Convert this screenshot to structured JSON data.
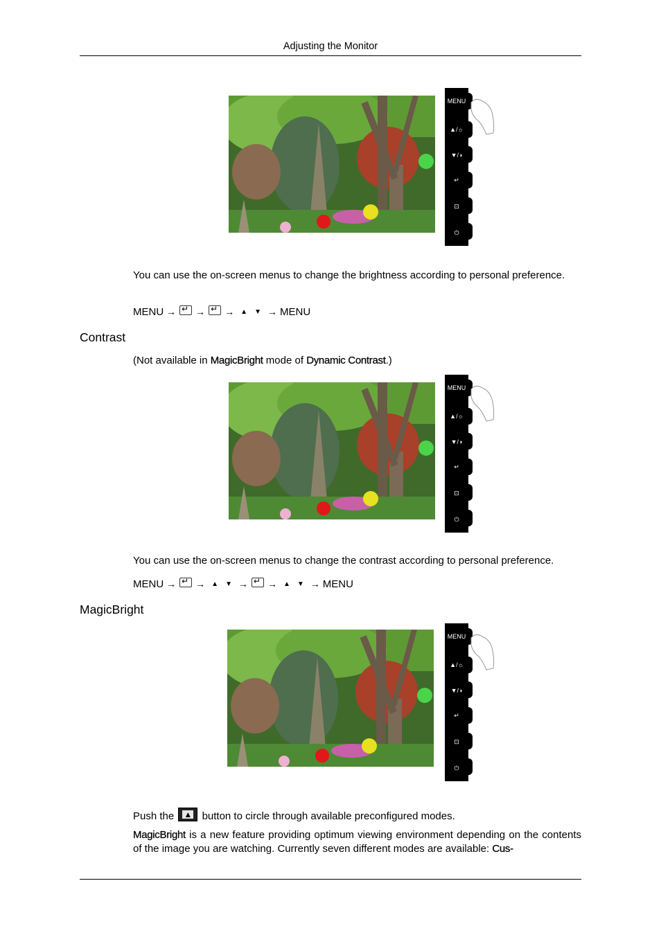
{
  "header": {
    "title": "Adjusting the Monitor"
  },
  "panel_buttons": [
    {
      "label": "MENU",
      "icon": "menu-icon"
    },
    {
      "label": "▲/☼",
      "icon": "up-brightness-icon"
    },
    {
      "label": "▼/◑",
      "icon": "down-contrast-icon"
    },
    {
      "label": "↵",
      "icon": "enter-icon"
    },
    {
      "label": "⊡",
      "icon": "magicbright-icon"
    },
    {
      "label": "⏻",
      "icon": "power-icon"
    }
  ],
  "brightness": {
    "description": "You can use the on-screen menus to change the brightness according to personal preference.",
    "sequence": [
      "MENU",
      "→",
      "enter",
      "→",
      "enter",
      "→",
      "▲",
      "▼",
      "→",
      "MENU"
    ]
  },
  "contrast": {
    "heading": "Contrast",
    "note_prefix": "(Not available in ",
    "note_mode": "MagicBright",
    "note_middle": " mode of ",
    "note_feature": "Dynamic Contrast",
    "note_suffix": ".)",
    "description": "You can use the on-screen menus to change the contrast according to personal preference.",
    "sequence": [
      "MENU",
      "→",
      "enter",
      "→",
      "▲",
      "▼",
      "→",
      "enter",
      "→",
      "▲",
      "▼",
      "→",
      "MENU"
    ]
  },
  "magicbright": {
    "heading": "MagicBright",
    "push_prefix": "Push the",
    "push_suffix": "button to circle through available preconfigured modes.",
    "desc_term": "MagicBright",
    "desc_text": " is a new feature providing optimum viewing environment depending on the contents of the image you are watching. Currently seven different modes are available: ",
    "desc_tail": "Cus-"
  }
}
